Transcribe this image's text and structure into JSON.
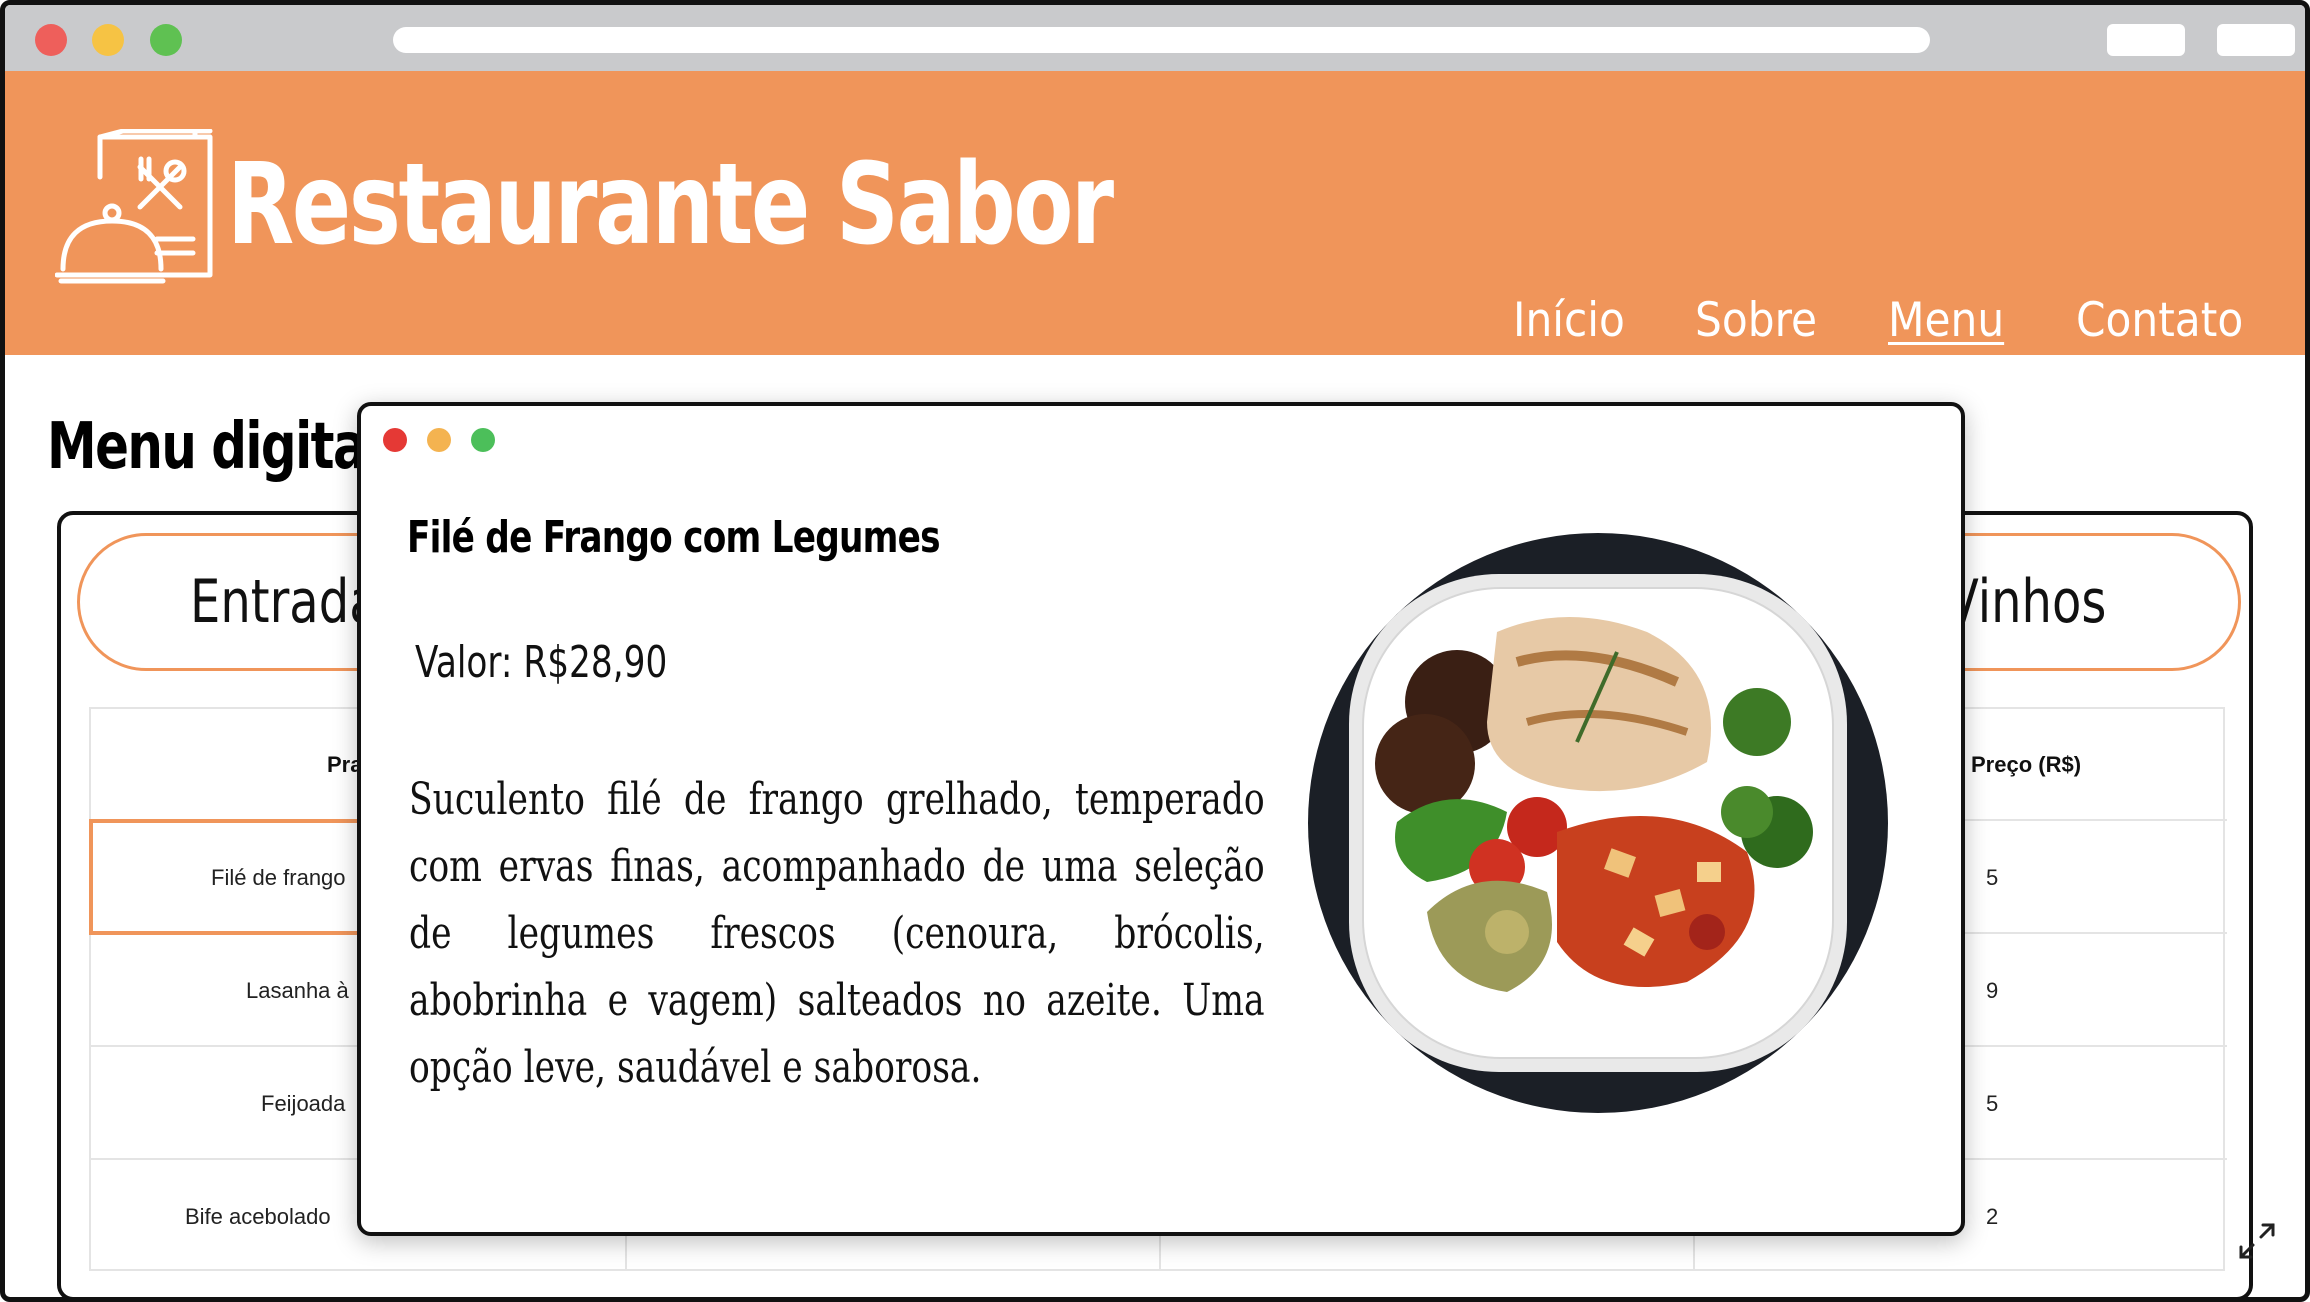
{
  "browser": {
    "url": "",
    "traffic_lights": [
      "#ee5f5b",
      "#f6c344",
      "#5fc152"
    ]
  },
  "header": {
    "brand": "Restaurante Sabor",
    "logo_icon": "menu-cloche-icon",
    "background": "#f0955a",
    "nav": [
      "Início",
      "Sobre",
      "Menu",
      "Contato"
    ],
    "active_nav": "Menu"
  },
  "page": {
    "title": "Menu digital",
    "tabs": [
      "Entradas",
      "Vinhos"
    ],
    "table": {
      "headers": [
        "Prato",
        "Preço (R$)"
      ],
      "rows": [
        {
          "name": "Filé de frango",
          "price": "5"
        },
        {
          "name": "Lasanha à",
          "price": "9"
        },
        {
          "name": "Feijoada",
          "price": "5"
        },
        {
          "name": "Bife acebolado",
          "price": "2"
        }
      ]
    }
  },
  "modal": {
    "traffic_lights": [
      "#e53935",
      "#f4b350",
      "#4cbf5a"
    ],
    "title": "Filé de Frango com Legumes",
    "price": "Valor: R$28,90",
    "description": "Suculento filé de frango grelhado, temperado com ervas finas, acompanhado de uma seleção de legumes frescos (cenoura, brócolis, abobrinha e vagem) salteados no azeite. Uma opção leve, saudável e saborosa.",
    "image_icon": "food-plate-image"
  },
  "expand_icon": "expand-icon",
  "accent": "#f0955a"
}
